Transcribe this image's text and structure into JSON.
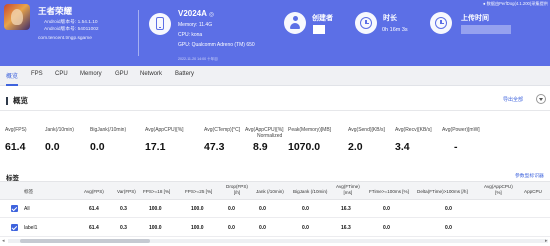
{
  "header": {
    "app_name": "王者荣耀",
    "android_version": "Android版本号: 1.54.1.10",
    "sdk_version": "Android版本号: 54011002",
    "package": "com.tencent.tmgp.sgame",
    "device_model": "V2024A",
    "device_model_suffix": "◎",
    "memory": "Memory: 11.4G",
    "cpu": "CPU: kona",
    "gpu": "GPU: Qualcomm Adreno (TM) 650",
    "creator_label": "创建者",
    "duration_label": "时长",
    "duration_value": "0h 16m 3s",
    "upload_label": "上传时间",
    "note": "数据由PerfDog(4.1.200)采集提供",
    "small_note": "2022-11-20 14:00 十年目",
    "accent": "#5c6fe6"
  },
  "tabs": [
    "概览",
    "FPS",
    "CPU",
    "Memory",
    "GPU",
    "Network",
    "Battery"
  ],
  "overview": {
    "title": "概览",
    "export_label": "导出全部",
    "metrics": [
      {
        "label": "Avg(FPS)",
        "value": "61.4"
      },
      {
        "label": "Jank(/10min)",
        "value": "0.0"
      },
      {
        "label": "BigJank(/10min)",
        "value": "0.0"
      },
      {
        "label": "Avg(AppCPU)[%]",
        "value": "17.1"
      },
      {
        "label": "Avg(CTemp)[°C]",
        "value": "47.3"
      },
      {
        "label": "Avg(AppCPU)[%]",
        "label2": "Normalized",
        "value": "8.9"
      },
      {
        "label": "Peak(Memory)[MB]",
        "value": "1070.0"
      },
      {
        "label": "Avg(Send)[KB/s]",
        "value": "2.0"
      },
      {
        "label": "Avg(Recv)[KB/s]",
        "value": "3.4"
      },
      {
        "label": "Avg(Power)[mW]",
        "value": "-"
      }
    ]
  },
  "labels_section": {
    "title": "标签",
    "params_link": "参数型标识器",
    "columns": [
      {
        "line1": "标签"
      },
      {
        "line1": "Avg(FPS)"
      },
      {
        "line1": "Var(FPS)"
      },
      {
        "line1": "FPS>=18 [%]"
      },
      {
        "line1": "FPS>=25 [%]"
      },
      {
        "line1": "Drop(FPS)",
        "line2": "[/h]"
      },
      {
        "line1": "Jank (/10min)"
      },
      {
        "line1": "BigJank (/10min)"
      },
      {
        "line1": "Avg(FTime)",
        "line2": "[ms]"
      },
      {
        "line1": "FTime>=100ms [%]"
      },
      {
        "line1": "Delta(FTime)>100ms [/h]"
      },
      {
        "line1": "Avg(AppCPU)",
        "line2": "[%]"
      },
      {
        "line1": "AppCPU"
      }
    ],
    "rows": [
      {
        "name": "All",
        "cells": [
          "61.4",
          "0.3",
          "100.0",
          "100.0",
          "0.0",
          "0.0",
          "0.0",
          "16.3",
          "0.0",
          "0.0",
          "",
          ""
        ]
      },
      {
        "name": "label1",
        "cells": [
          "61.4",
          "0.3",
          "100.0",
          "100.0",
          "0.0",
          "0.0",
          "0.0",
          "16.3",
          "0.0",
          "0.0",
          "",
          ""
        ]
      }
    ]
  }
}
